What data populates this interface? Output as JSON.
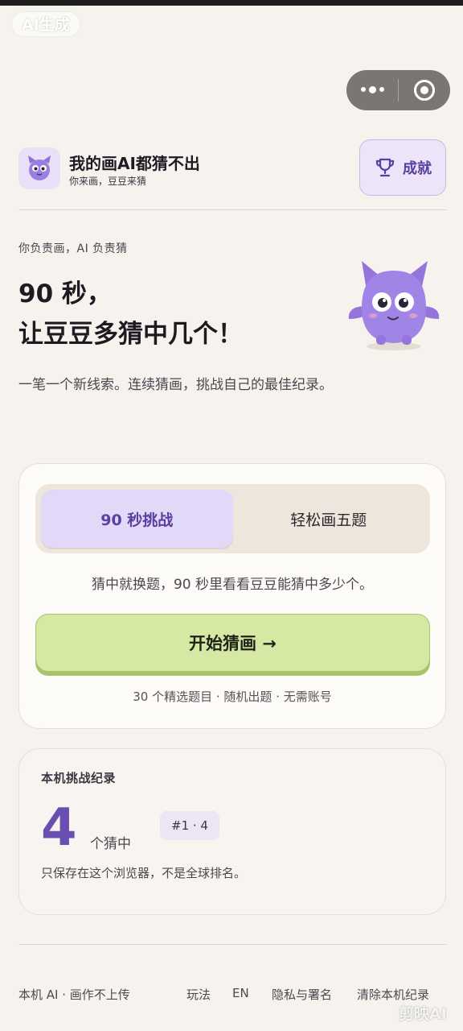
{
  "overlay": {
    "ai_badge": "AI生成",
    "watermark": "剪映AI"
  },
  "header": {
    "title": "我的画AI都猜不出",
    "subtitle": "你来画，豆豆来猜",
    "achievements_label": "成就"
  },
  "hero": {
    "tagline": "你负责画，AI 负责猜",
    "title_line1": "90 秒，",
    "title_line2": "让豆豆多猜中几个！",
    "description": "一笔一个新线索。连续猜画，挑战自己的最佳纪录。"
  },
  "mode_card": {
    "tabs": [
      {
        "label": "90 秒挑战",
        "active": true
      },
      {
        "label": "轻松画五题",
        "active": false
      }
    ],
    "mode_description": "猜中就换题，90 秒里看看豆豆能猜中多少个。",
    "start_label": "开始猜画 →",
    "note": "30 个精选题目 · 随机出题 · 无需账号"
  },
  "record_card": {
    "title": "本机挑战纪录",
    "count": "4",
    "unit": "个猜中",
    "rank": "#1 · 4",
    "note": "只保存在这个浏览器，不是全球排名。"
  },
  "footer": {
    "left_text": "本机 AI · 画作不上传",
    "links": [
      "玩法",
      "EN",
      "隐私与署名",
      "清除本机纪录"
    ]
  },
  "colors": {
    "accent": "#5b3fa0",
    "start_button": "#d5e8a4",
    "mascot": "#9c7de0"
  },
  "icons": [
    "more-dots-icon",
    "close-target-icon",
    "trophy-icon",
    "mascot-icon"
  ]
}
